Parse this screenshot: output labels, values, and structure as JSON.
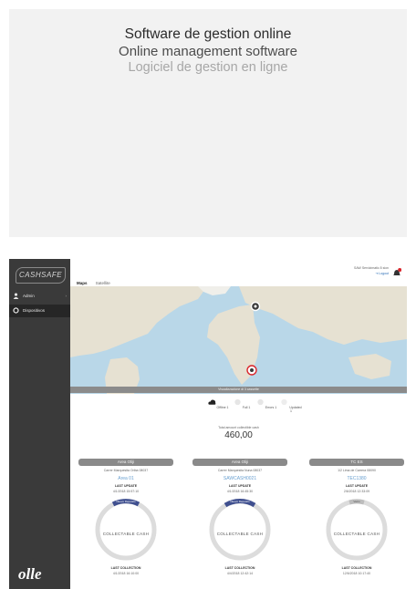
{
  "headline": {
    "es": "Software de gestion online",
    "en": "Online management software",
    "fr": "Logiciel de gestion en ligne"
  },
  "app": {
    "logo_text": "CASHSAFE",
    "brand_text": "olle",
    "sidebar": {
      "items": [
        {
          "label": "Admin",
          "icon": "user-icon"
        },
        {
          "label": "Dispositivos",
          "icon": "circle-icon",
          "active": true
        }
      ]
    },
    "header": {
      "tabs": [
        {
          "label": "Maps",
          "active": true
        },
        {
          "label": "Satellite",
          "active": false
        }
      ],
      "user_line": "SAW Servizimatic 8 sion",
      "logout": "Logout",
      "notifications_count": "8"
    },
    "map": {
      "banner": "Visualizzazione di 3 cassette",
      "markers": [
        "marker-europe",
        "marker-africa"
      ]
    },
    "status_filters": [
      {
        "label": "Offline 1",
        "icon": "cloud-icon"
      },
      {
        "label": "Full 1",
        "icon": "full-icon"
      },
      {
        "label": "Errors 1",
        "icon": "error-icon"
      },
      {
        "label": "Updated 1",
        "icon": "updated-icon"
      }
    ],
    "total_label": "Total amount collectible cash",
    "total_value": "460,00",
    "devices": [
      {
        "name": "Area Oliji",
        "address": "Carrer Marquesita Oriba 08037",
        "serial": "Area 01",
        "last_update_label": "LAST UPDATE",
        "last_update": "4/1/2018    15:57:10",
        "collectable": "COLLECTABLE CASH",
        "last_collection_label": "LAST COLLECTION",
        "last_collection": "4/1/2018    16:10:00",
        "badge": "Nuevo Deposito"
      },
      {
        "name": "Area Oliji",
        "address": "Carrer Marquesita Nuna 08037",
        "serial": "SAWCASH0021",
        "last_update_label": "LAST UPDATE",
        "last_update": "4/1/2018    16:45:30",
        "collectable": "COLLECTABLE CASH",
        "last_collection_label": "LAST COLLECTION",
        "last_collection": "4/4/2018    12:42:14",
        "badge": "Nuevo Deposito"
      },
      {
        "name": "TC ES",
        "address": "1/2 Lima de Carrera 08090",
        "serial": "TEC1380",
        "last_update_label": "LAST UPDATE",
        "last_update": "2/6/2018    12:33:09",
        "collectable": "COLLECTABLE CASH",
        "last_collection_label": "LAST COLLECTION",
        "last_collection": "12/6/2018    10:17:40",
        "badge": "Vacio"
      }
    ],
    "colors": {
      "sidebar": "#3a3a3a",
      "accent": "#2a6db5",
      "badge": "#3f4f8f",
      "alert": "#d9262c"
    }
  }
}
